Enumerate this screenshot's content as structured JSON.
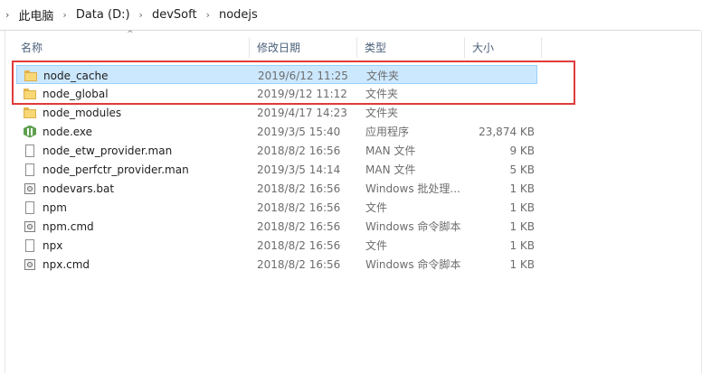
{
  "breadcrumb": [
    "此电脑",
    "Data (D:)",
    "devSoft",
    "nodejs"
  ],
  "columns": {
    "name": "名称",
    "date": "修改日期",
    "type": "类型",
    "size": "大小"
  },
  "files": [
    {
      "name": "node_cache",
      "date": "2019/6/12 11:25",
      "type": "文件夹",
      "size": "",
      "icon": "folder-icon",
      "selected": true
    },
    {
      "name": "node_global",
      "date": "2019/9/12 11:12",
      "type": "文件夹",
      "size": "",
      "icon": "folder-icon",
      "selected": false
    },
    {
      "name": "node_modules",
      "date": "2019/4/17 14:23",
      "type": "文件夹",
      "size": "",
      "icon": "folder-icon",
      "selected": false
    },
    {
      "name": "node.exe",
      "date": "2019/3/5 15:40",
      "type": "应用程序",
      "size": "23,874 KB",
      "icon": "node-exe-icon",
      "selected": false
    },
    {
      "name": "node_etw_provider.man",
      "date": "2018/8/2 16:56",
      "type": "MAN 文件",
      "size": "9 KB",
      "icon": "file-icon",
      "selected": false
    },
    {
      "name": "node_perfctr_provider.man",
      "date": "2019/3/5 14:14",
      "type": "MAN 文件",
      "size": "5 KB",
      "icon": "file-icon",
      "selected": false
    },
    {
      "name": "nodevars.bat",
      "date": "2018/8/2 16:56",
      "type": "Windows 批处理...",
      "size": "1 KB",
      "icon": "batch-file-icon",
      "selected": false
    },
    {
      "name": "npm",
      "date": "2018/8/2 16:56",
      "type": "文件",
      "size": "1 KB",
      "icon": "file-icon",
      "selected": false
    },
    {
      "name": "npm.cmd",
      "date": "2018/8/2 16:56",
      "type": "Windows 命令脚本",
      "size": "1 KB",
      "icon": "batch-file-icon",
      "selected": false
    },
    {
      "name": "npx",
      "date": "2018/8/2 16:56",
      "type": "文件",
      "size": "1 KB",
      "icon": "file-icon",
      "selected": false
    },
    {
      "name": "npx.cmd",
      "date": "2018/8/2 16:56",
      "type": "Windows 命令脚本",
      "size": "1 KB",
      "icon": "batch-file-icon",
      "selected": false
    }
  ],
  "colors": {
    "selection": "#cce8ff",
    "selection_border": "#99d1ff",
    "annotation": "#e03b3b"
  }
}
